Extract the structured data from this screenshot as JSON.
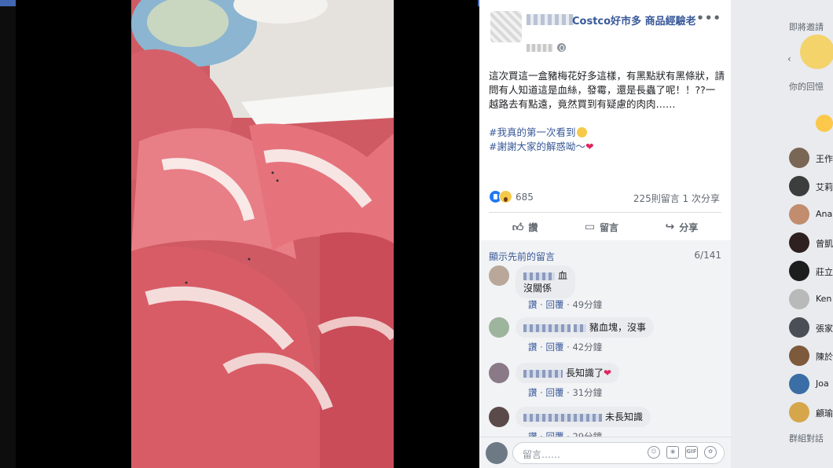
{
  "post": {
    "group_name": "Costco好市多 商品經驗老",
    "more_icon": "more-icon",
    "body_text": "這次買這一盒豬梅花好多這樣，有黑點狀有黑條狀，請問有人知道這是血絲，發霉，還是長蟲了呢！！??一越路去有點遠，竟然買到有疑慮的肉肉……",
    "hashtag1": "#我真的第一次看到",
    "hashtag2": "#謝謝大家的解惑呦～",
    "reaction_count": "685",
    "comment_share_counts": "225則留言 1 次分享",
    "actions": {
      "like": "讚",
      "comment": "留言",
      "share": "分享"
    }
  },
  "comments": {
    "prev_link": "顯示先前的留言",
    "pager": "6/141",
    "like_label": "讚",
    "reply_label": "回覆",
    "items": [
      {
        "text_line1": "血",
        "text_line2": "沒關係",
        "time": "49分鐘"
      },
      {
        "text_line1": "豬血塊，沒事",
        "time": "42分鐘"
      },
      {
        "text_line1": "長知識了",
        "time": "31分鐘"
      },
      {
        "text_line1": "未長知識",
        "time": "29分鐘"
      }
    ]
  },
  "composer": {
    "placeholder": "留言……",
    "icons": [
      "emoji-icon",
      "camera-icon",
      "gif-icon",
      "sticker-icon"
    ]
  },
  "rail": {
    "title_top": "即將邀請",
    "title_mid": "你的回憶",
    "title_bottom": "群組對話",
    "contacts": [
      "王作",
      "艾莉",
      "Ana",
      "曾凱",
      "莊立",
      "Ken",
      "張家",
      "陳於",
      "Joa",
      "顧瑜"
    ]
  },
  "colors": {
    "accent": "#4267b2",
    "link": "#385898",
    "heart": "#e0245e"
  }
}
